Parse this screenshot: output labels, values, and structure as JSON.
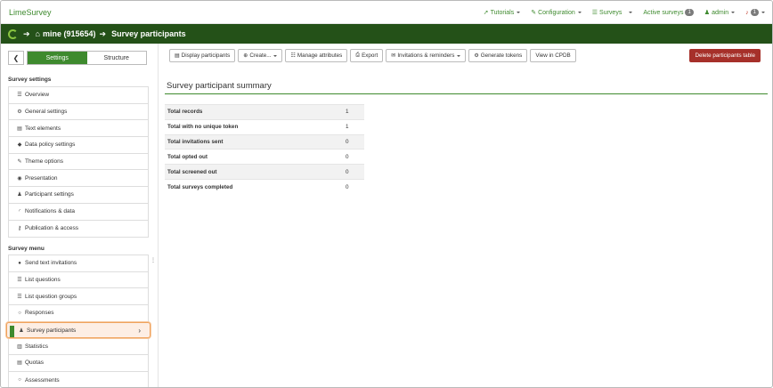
{
  "brand": "LimeSurvey",
  "topnav": {
    "tutorials": "Tutorials",
    "configuration": "Configuration",
    "surveys": "Surveys",
    "active_surveys": "Active surveys",
    "active_surveys_count": "1",
    "user": "admin",
    "notifications_count": "1"
  },
  "titlebar": {
    "survey": "mine (915654)",
    "page": "Survey participants"
  },
  "sidebar": {
    "tabs": [
      {
        "label": "Settings",
        "active": true
      },
      {
        "label": "Structure",
        "active": false
      }
    ],
    "settings_title": "Survey settings",
    "settings_items": [
      {
        "icon": "list-icon",
        "glyph": "☰",
        "label": "Overview"
      },
      {
        "icon": "cogs-icon",
        "glyph": "⚙",
        "label": "General settings"
      },
      {
        "icon": "file-text-icon",
        "glyph": "▤",
        "label": "Text elements"
      },
      {
        "icon": "shield-icon",
        "glyph": "◆",
        "label": "Data policy settings"
      },
      {
        "icon": "paintbrush-icon",
        "glyph": "✎",
        "label": "Theme options"
      },
      {
        "icon": "eye-slash-icon",
        "glyph": "◉",
        "label": "Presentation"
      },
      {
        "icon": "users-icon",
        "glyph": "♟",
        "label": "Participant settings"
      },
      {
        "icon": "feed-icon",
        "glyph": "◜",
        "label": "Notifications & data"
      },
      {
        "icon": "key-icon",
        "glyph": "⚷",
        "label": "Publication & access"
      }
    ],
    "menu_title": "Survey menu",
    "menu_items": [
      {
        "icon": "comment-icon",
        "glyph": "●",
        "label": "Send text invitations"
      },
      {
        "icon": "list-icon",
        "glyph": "☰",
        "label": "List questions"
      },
      {
        "icon": "list-icon",
        "glyph": "☰",
        "label": "List question groups"
      },
      {
        "icon": "comment-o-icon",
        "glyph": "○",
        "label": "Responses"
      },
      {
        "icon": "user-icon",
        "glyph": "♟",
        "label": "Survey participants",
        "active": true
      },
      {
        "icon": "bar-chart-icon",
        "glyph": "▥",
        "label": "Statistics"
      },
      {
        "icon": "tasks-icon",
        "glyph": "▤",
        "label": "Quotas"
      },
      {
        "icon": "comment-o-icon",
        "glyph": "○",
        "label": "Assessments"
      }
    ]
  },
  "toolbar": {
    "display_participants": "Display participants",
    "create": "Create...",
    "manage_attributes": "Manage attributes",
    "export": "Export",
    "invitations": "Invitations & reminders",
    "generate_tokens": "Generate tokens",
    "view_cpdb": "View in CPDB",
    "delete_table": "Delete participants table"
  },
  "summary": {
    "title": "Survey participant summary",
    "rows": [
      {
        "label": "Total records",
        "value": "1"
      },
      {
        "label": "Total with no unique token",
        "value": "1"
      },
      {
        "label": "Total invitations sent",
        "value": "0"
      },
      {
        "label": "Total opted out",
        "value": "0"
      },
      {
        "label": "Total screened out",
        "value": "0"
      },
      {
        "label": "Total surveys completed",
        "value": "0"
      }
    ]
  },
  "colors": {
    "brand_green": "#3e8a2e",
    "titlebar_green": "#245118",
    "danger": "#a6302a"
  }
}
